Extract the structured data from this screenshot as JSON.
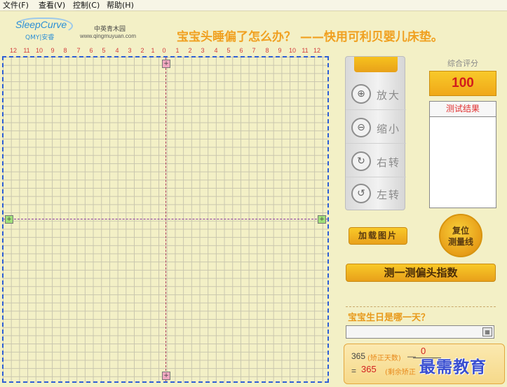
{
  "menu": {
    "items": [
      "文件(F)",
      "查看(V)",
      "控制(C)",
      "帮助(H)"
    ]
  },
  "header": {
    "logo": "SleepCurve",
    "logo_sub": "QMY|安睿",
    "partner_name": "中英青木园",
    "partner_url": "www.qingmuyuan.com",
    "slogan": "宝宝头睡偏了怎么办？ ——快用可利贝婴儿床垫。"
  },
  "ruler": {
    "labels": [
      "12",
      "11",
      "10",
      "9",
      "8",
      "7",
      "6",
      "5",
      "4",
      "3",
      "2",
      "1",
      "0",
      "1",
      "2",
      "3",
      "4",
      "5",
      "6",
      "7",
      "8",
      "9",
      "10",
      "11",
      "12"
    ]
  },
  "grid": {
    "handle_top": "+",
    "handle_bottom": "+",
    "handle_left": "+",
    "handle_right": "+"
  },
  "tools": {
    "zoom_in_icon": "⊕",
    "zoom_in": "放大",
    "zoom_out_icon": "⊖",
    "zoom_out": "缩小",
    "rotate_right_icon": "↻",
    "rotate_right": "右转",
    "rotate_left_icon": "↺",
    "rotate_left": "左转"
  },
  "score": {
    "label": "综合评分",
    "value": "100"
  },
  "result": {
    "header": "测试结果"
  },
  "buttons": {
    "load_image": "加载图片",
    "reset_line_1": "复位",
    "reset_line_2": "测量线",
    "measure": "测一测偏头指数"
  },
  "birthday": {
    "label": "宝宝生日是哪一天？",
    "value": "",
    "calendar_icon": "▦"
  },
  "calc": {
    "total": "365",
    "corrected_label": "(矫正天数)",
    "minus": "—",
    "corrected_days": "0",
    "equals": "=",
    "remaining": "365",
    "remaining_label": "(剩余矫正"
  },
  "watermark": "最需教育"
}
